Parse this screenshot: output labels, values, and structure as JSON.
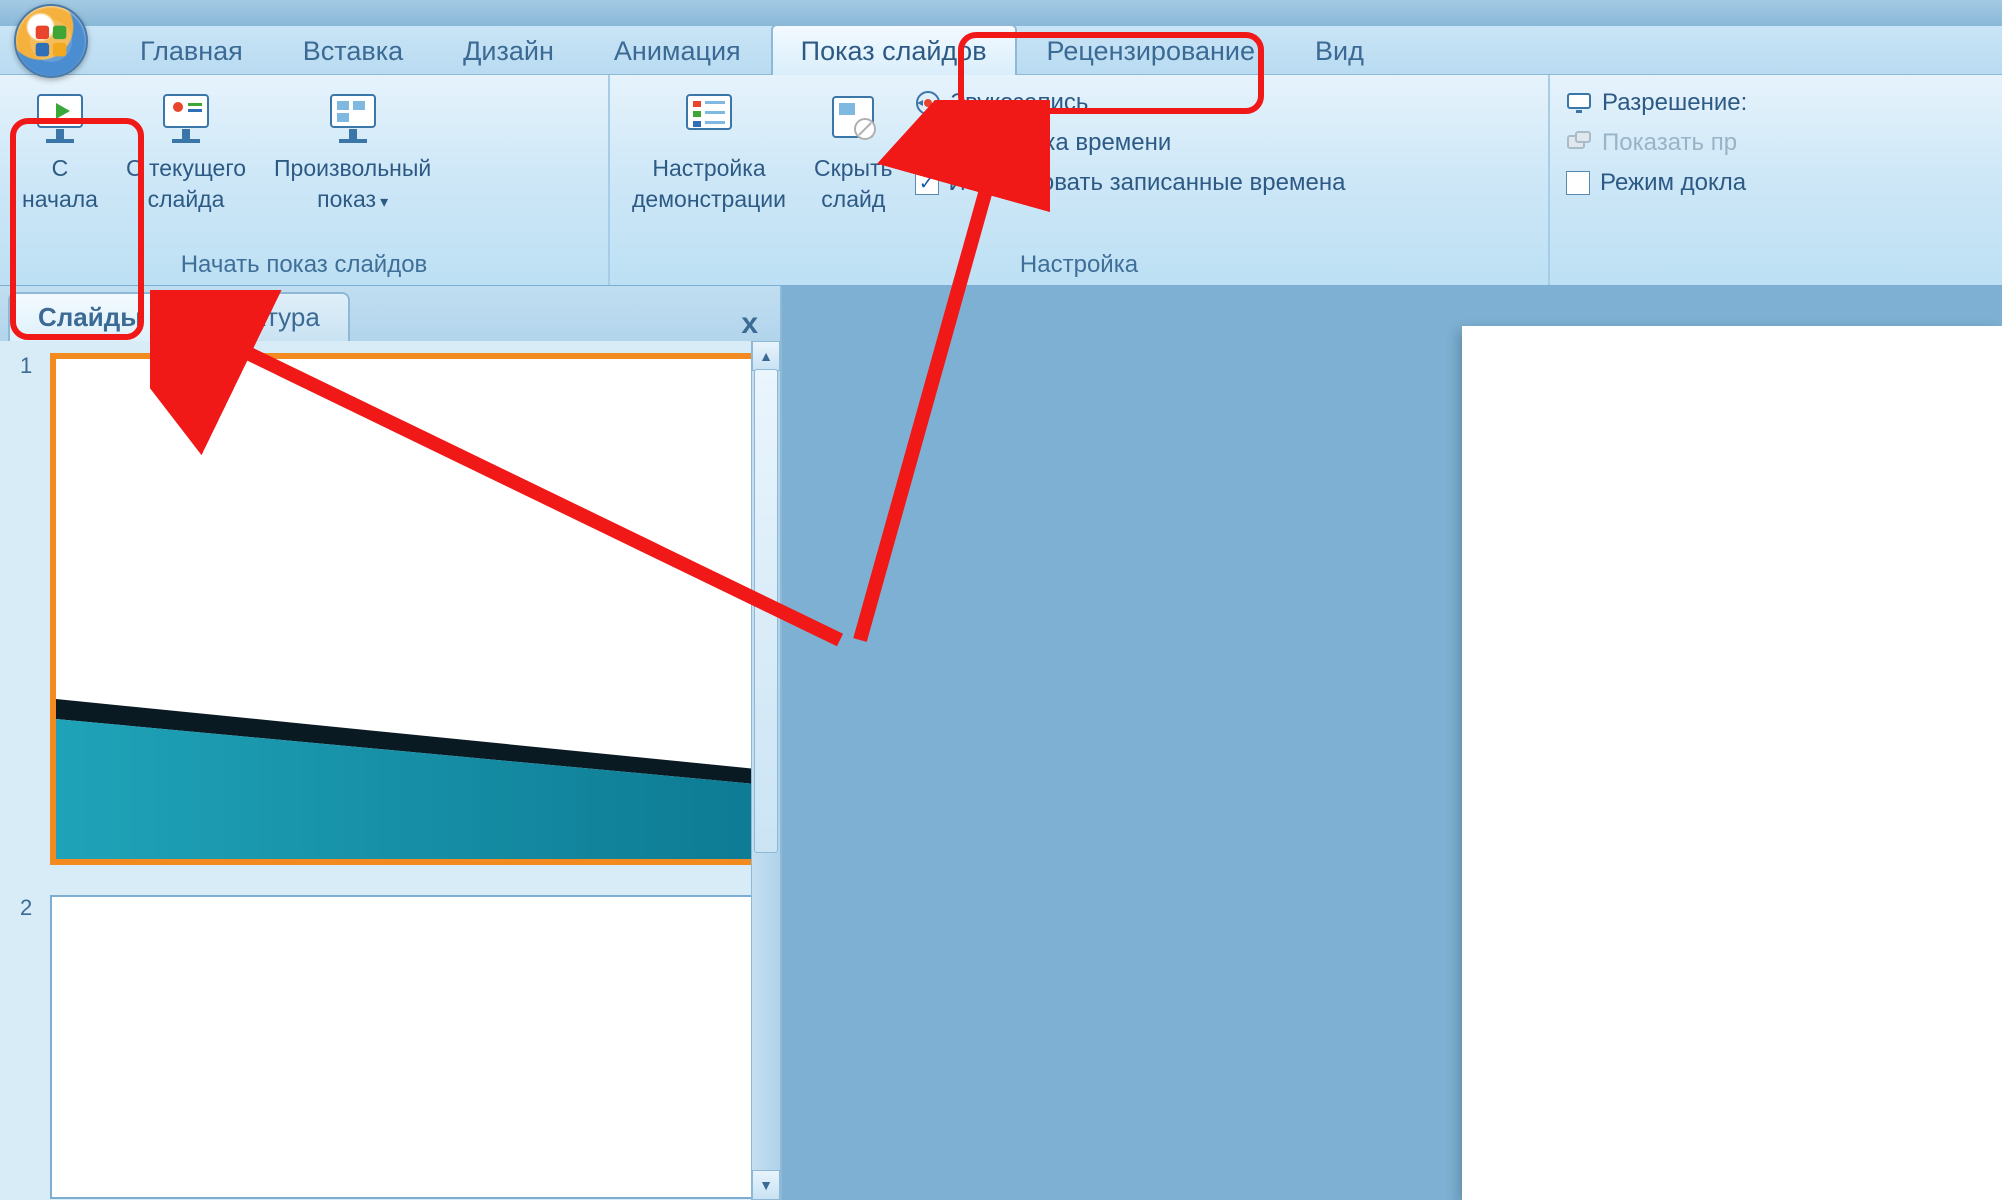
{
  "tabs": {
    "home": "Главная",
    "insert": "Вставка",
    "design": "Дизайн",
    "animation": "Анимация",
    "slideshow": "Показ слайдов",
    "review": "Рецензирование",
    "view": "Вид"
  },
  "ribbon": {
    "group_start": {
      "label": "Начать показ слайдов",
      "from_beginning_l1": "С",
      "from_beginning_l2": "начала",
      "from_current_l1": "С текущего",
      "from_current_l2": "слайда",
      "custom_l1": "Произвольный",
      "custom_l2": "показ"
    },
    "group_setup": {
      "label": "Настройка",
      "setup_show_l1": "Настройка",
      "setup_show_l2": "демонстрации",
      "hide_slide_l1": "Скрыть",
      "hide_slide_l2": "слайд",
      "record": "Звукозапись",
      "rehearse": "Настройка времени",
      "use_timings": "Использовать записанные времена"
    },
    "group_monitors": {
      "resolution": "Разрешение:",
      "show_on": "Показать пр",
      "presenter": "Режим докла"
    }
  },
  "sidepane": {
    "tab_slides": "Слайды",
    "tab_outline": "Структура",
    "close": "x",
    "thumb1_num": "1",
    "thumb2_num": "2"
  },
  "checkmark": "✓",
  "dropdown_glyph": "▾",
  "arrow_up": "▲",
  "arrow_down": "▼"
}
